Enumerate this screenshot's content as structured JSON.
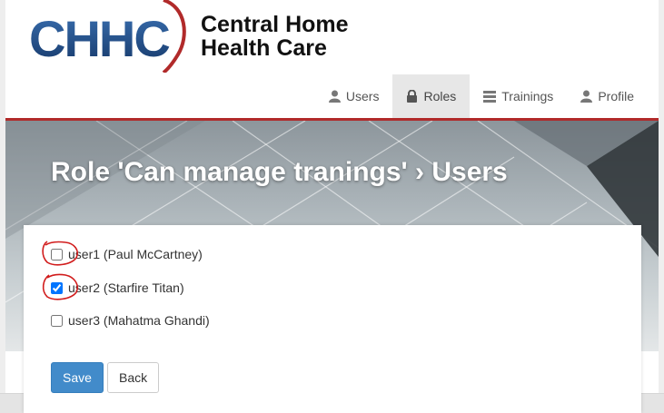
{
  "brand": {
    "logo_letters": "CHHC",
    "name_line1": "Central Home",
    "name_line2": "Health Care",
    "accent_color": "#b12a2a",
    "logo_blue": "#1f4f8a"
  },
  "nav": {
    "items": [
      {
        "label": "Users",
        "icon": "user-icon",
        "active": false
      },
      {
        "label": "Roles",
        "icon": "lock-icon",
        "active": true
      },
      {
        "label": "Trainings",
        "icon": "list-icon",
        "active": false
      },
      {
        "label": "Profile",
        "icon": "user-icon",
        "active": false
      }
    ]
  },
  "page": {
    "title": "Role 'Can manage tranings' › Users"
  },
  "users": [
    {
      "label": "user1 (Paul McCartney)",
      "checked": false
    },
    {
      "label": "user2 (Starfire Titan)",
      "checked": true
    },
    {
      "label": "user3 (Mahatma Ghandi)",
      "checked": false
    }
  ],
  "actions": {
    "save_label": "Save",
    "back_label": "Back"
  }
}
